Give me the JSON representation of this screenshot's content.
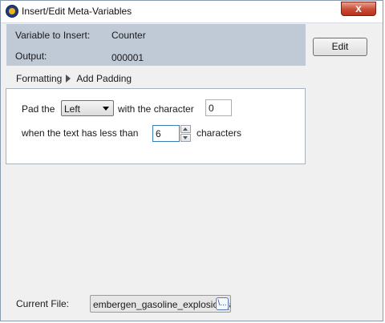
{
  "window": {
    "title": "Insert/Edit Meta-Variables",
    "close_label": "x"
  },
  "info": {
    "variable_label": "Variable to Insert:",
    "variable_value": "Counter",
    "output_label": "Output:",
    "output_value": "000001"
  },
  "edit_button": "Edit",
  "breadcrumb": {
    "parent": "Formatting",
    "current": "Add Padding"
  },
  "padding": {
    "pad_the_label": "Pad the",
    "side_value": "Left",
    "with_char_label": "with the character",
    "character_value": "0",
    "when_label": "when the text has less than",
    "length_value": "6",
    "characters_label": "characters"
  },
  "current_file": {
    "label": "Current File:",
    "value": "embergen_gasoline_explosion_a",
    "icon_glyph": "\\..."
  },
  "colors": {
    "info_panel_bg": "#bfcad6",
    "close_button": "#c94a33"
  }
}
